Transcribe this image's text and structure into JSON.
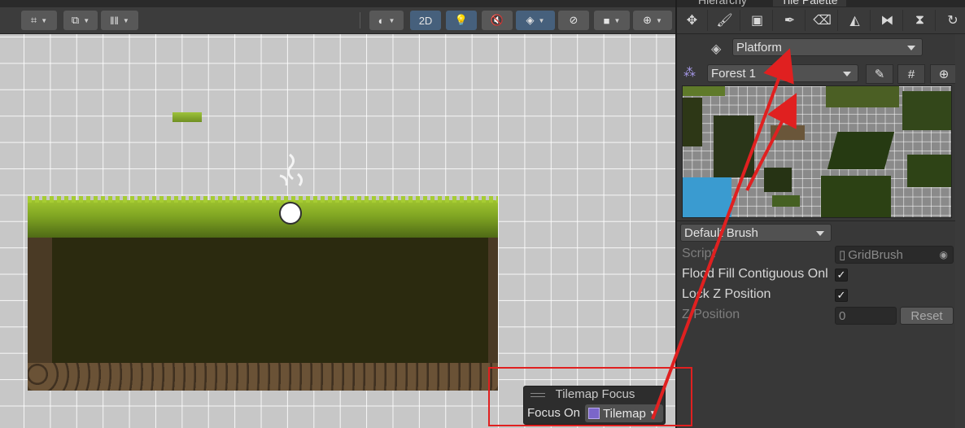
{
  "scene": {
    "toolbar": {
      "buttons": [
        {
          "icon": "grid-snap-icon",
          "glyph": "⌗"
        },
        {
          "icon": "increment-snap-icon",
          "glyph": "⧉"
        },
        {
          "icon": "ruler-icon",
          "glyph": "𝄃"
        }
      ],
      "two_d_label": "2D",
      "right_icons": [
        "shading-mode-icon",
        "lighting-icon",
        "audio-icon",
        "effects-icon",
        "visibility-icon",
        "camera-icon",
        "gizmos-icon"
      ]
    },
    "tilemap_focus": {
      "title": "Tilemap Focus",
      "label": "Focus On",
      "value": "Tilemap"
    }
  },
  "panel": {
    "tabs": [
      "Hierarchy",
      "Tile Palette"
    ],
    "active_tab": "Tile Palette",
    "tools": [
      "select-icon",
      "paint-icon",
      "box-fill-icon",
      "picker-icon",
      "erase-icon",
      "fill-icon",
      "flip-x-icon",
      "flip-y-icon",
      "rotate-icon"
    ],
    "active_tilemap": "Platform",
    "palette": "Forest 1",
    "brush": "Default Brush",
    "properties": {
      "script_label": "Script",
      "script_value": "GridBrush",
      "flood_fill_label": "Flood Fill Contiguous Onl",
      "flood_fill_checked": true,
      "lock_z_label": "Lock Z Position",
      "lock_z_checked": true,
      "z_position_label": "Z Position",
      "z_position_value": "0",
      "reset_label": "Reset"
    }
  },
  "colors": {
    "annotation": "#e02020",
    "scene_background": "#c7c7c7",
    "panel_background": "#383838"
  }
}
